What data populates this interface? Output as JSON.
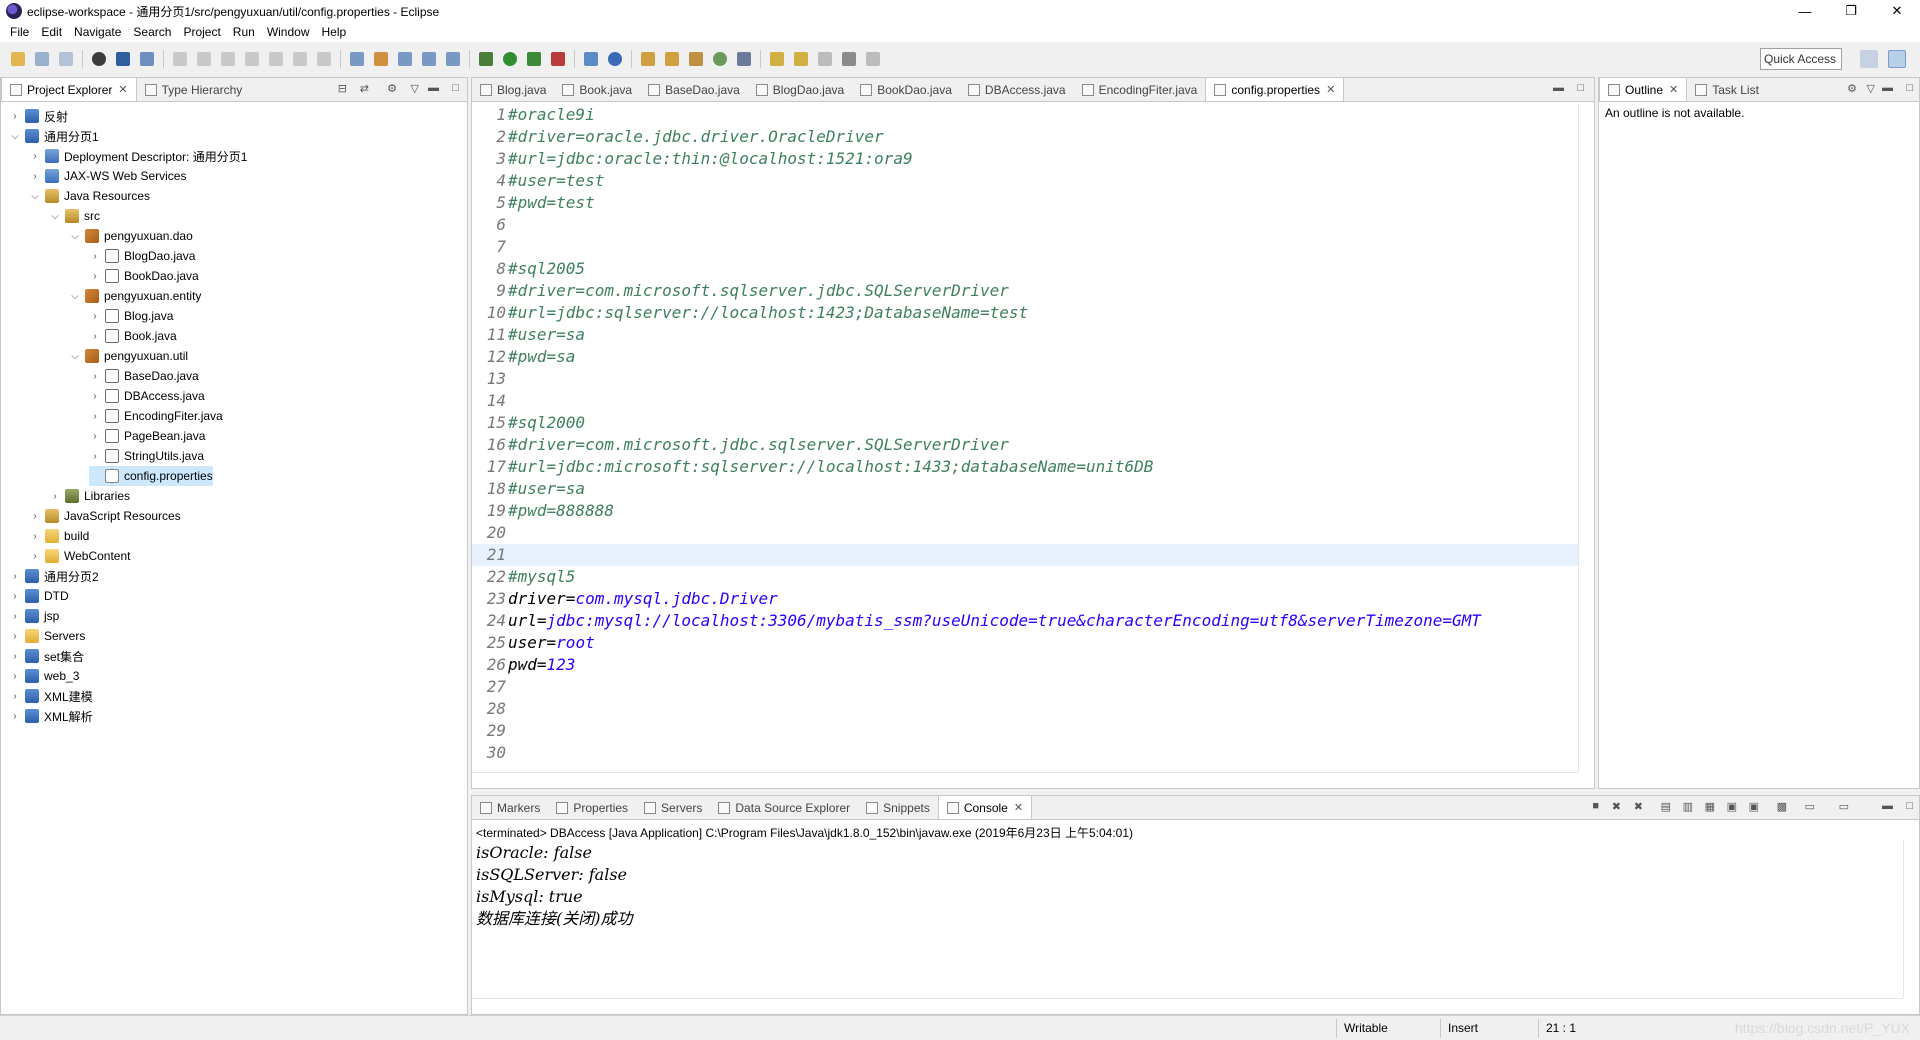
{
  "window": {
    "title": "eclipse-workspace - 通用分页1/src/pengyuxuan/util/config.properties - Eclipse",
    "minimize": "—",
    "maximize": "❐",
    "close": "✕"
  },
  "menu": [
    "File",
    "Edit",
    "Navigate",
    "Search",
    "Project",
    "Run",
    "Window",
    "Help"
  ],
  "toolbar": {
    "quick_access": "Quick Access"
  },
  "explorer": {
    "tabs": [
      {
        "label": "Project Explorer",
        "close": "✕"
      },
      {
        "label": "Type Hierarchy"
      }
    ],
    "tree": [
      {
        "label": "反射",
        "depth": 0,
        "expanded": false,
        "icon": "project-icon"
      },
      {
        "label": "通用分页1",
        "depth": 0,
        "expanded": true,
        "icon": "project-icon"
      },
      {
        "label": "Deployment Descriptor: 通用分页1",
        "depth": 1,
        "expanded": false,
        "icon": "descriptor-icon"
      },
      {
        "label": "JAX-WS Web Services",
        "depth": 1,
        "expanded": false,
        "icon": "webservice-icon"
      },
      {
        "label": "Java Resources",
        "depth": 1,
        "expanded": true,
        "icon": "java-resources-icon"
      },
      {
        "label": "src",
        "depth": 2,
        "expanded": true,
        "icon": "source-folder-icon"
      },
      {
        "label": "pengyuxuan.dao",
        "depth": 3,
        "expanded": true,
        "icon": "package-icon"
      },
      {
        "label": "BlogDao.java",
        "depth": 4,
        "expanded": false,
        "icon": "java-file-icon"
      },
      {
        "label": "BookDao.java",
        "depth": 4,
        "expanded": false,
        "icon": "java-file-icon"
      },
      {
        "label": "pengyuxuan.entity",
        "depth": 3,
        "expanded": true,
        "icon": "package-icon"
      },
      {
        "label": "Blog.java",
        "depth": 4,
        "expanded": false,
        "icon": "java-file-icon"
      },
      {
        "label": "Book.java",
        "depth": 4,
        "expanded": false,
        "icon": "java-file-icon"
      },
      {
        "label": "pengyuxuan.util",
        "depth": 3,
        "expanded": true,
        "icon": "package-icon"
      },
      {
        "label": "BaseDao.java",
        "depth": 4,
        "expanded": false,
        "icon": "java-file-icon"
      },
      {
        "label": "DBAccess.java",
        "depth": 4,
        "expanded": false,
        "icon": "java-file-icon"
      },
      {
        "label": "EncodingFiter.java",
        "depth": 4,
        "expanded": false,
        "icon": "java-file-icon"
      },
      {
        "label": "PageBean.java",
        "depth": 4,
        "expanded": false,
        "icon": "java-file-icon"
      },
      {
        "label": "StringUtils.java",
        "depth": 4,
        "expanded": false,
        "icon": "java-file-icon"
      },
      {
        "label": "config.properties",
        "depth": 4,
        "leaf": true,
        "selected": true,
        "icon": "properties-file-icon"
      },
      {
        "label": "Libraries",
        "depth": 2,
        "expanded": false,
        "icon": "library-icon"
      },
      {
        "label": "JavaScript Resources",
        "depth": 1,
        "expanded": false,
        "icon": "js-resources-icon"
      },
      {
        "label": "build",
        "depth": 1,
        "expanded": false,
        "icon": "folder-icon"
      },
      {
        "label": "WebContent",
        "depth": 1,
        "expanded": false,
        "icon": "folder-icon"
      },
      {
        "label": "通用分页2",
        "depth": 0,
        "expanded": false,
        "icon": "project-icon"
      },
      {
        "label": "DTD",
        "depth": 0,
        "expanded": false,
        "icon": "project-icon"
      },
      {
        "label": "jsp",
        "depth": 0,
        "expanded": false,
        "icon": "project-icon"
      },
      {
        "label": "Servers",
        "depth": 0,
        "expanded": false,
        "icon": "folder-icon"
      },
      {
        "label": "set集合",
        "depth": 0,
        "expanded": false,
        "icon": "project-icon"
      },
      {
        "label": "web_3",
        "depth": 0,
        "expanded": false,
        "icon": "project-icon"
      },
      {
        "label": "XML建模",
        "depth": 0,
        "expanded": false,
        "icon": "project-icon"
      },
      {
        "label": "XML解析",
        "depth": 0,
        "expanded": false,
        "icon": "project-icon"
      }
    ]
  },
  "editor": {
    "tabs": [
      {
        "label": "Blog.java"
      },
      {
        "label": "Book.java"
      },
      {
        "label": "BaseDao.java"
      },
      {
        "label": "BlogDao.java"
      },
      {
        "label": "BookDao.java"
      },
      {
        "label": "DBAccess.java"
      },
      {
        "label": "EncodingFiter.java"
      },
      {
        "label": "config.properties",
        "active": true,
        "close": "✕"
      }
    ],
    "current_line": 21,
    "lines": [
      {
        "n": "1",
        "type": "comment",
        "text": "#oracle9i"
      },
      {
        "n": "2",
        "type": "comment",
        "text": "#driver=oracle.jdbc.driver.OracleDriver"
      },
      {
        "n": "3",
        "type": "comment",
        "text": "#url=jdbc:oracle:thin:@localhost:1521:ora9"
      },
      {
        "n": "4",
        "type": "comment",
        "text": "#user=test"
      },
      {
        "n": "5",
        "type": "comment",
        "text": "#pwd=test"
      },
      {
        "n": "6",
        "type": "blank",
        "text": ""
      },
      {
        "n": "7",
        "type": "blank",
        "text": ""
      },
      {
        "n": "8",
        "type": "comment",
        "text": "#sql2005"
      },
      {
        "n": "9",
        "type": "comment",
        "text": "#driver=com.microsoft.sqlserver.jdbc.SQLServerDriver"
      },
      {
        "n": "10",
        "type": "comment",
        "text": "#url=jdbc:sqlserver://localhost:1423;DatabaseName=test"
      },
      {
        "n": "11",
        "type": "comment",
        "text": "#user=sa"
      },
      {
        "n": "12",
        "type": "comment",
        "text": "#pwd=sa"
      },
      {
        "n": "13",
        "type": "blank",
        "text": ""
      },
      {
        "n": "14",
        "type": "blank",
        "text": ""
      },
      {
        "n": "15",
        "type": "comment",
        "text": "#sql2000"
      },
      {
        "n": "16",
        "type": "comment",
        "text": "#driver=com.microsoft.jdbc.sqlserver.SQLServerDriver"
      },
      {
        "n": "17",
        "type": "comment",
        "text": "#url=jdbc:microsoft:sqlserver://localhost:1433;databaseName=unit6DB"
      },
      {
        "n": "18",
        "type": "comment",
        "text": "#user=sa"
      },
      {
        "n": "19",
        "type": "comment",
        "text": "#pwd=888888"
      },
      {
        "n": "20",
        "type": "blank",
        "text": ""
      },
      {
        "n": "21",
        "type": "blank",
        "text": ""
      },
      {
        "n": "22",
        "type": "comment",
        "text": "#mysql5"
      },
      {
        "n": "23",
        "type": "prop",
        "key": "driver=",
        "value": "com.mysql.jdbc.Driver"
      },
      {
        "n": "24",
        "type": "prop",
        "key": "url=",
        "value": "jdbc:mysql://localhost:3306/mybatis_ssm?useUnicode=true&characterEncoding=utf8&serverTimezone=GMT"
      },
      {
        "n": "25",
        "type": "prop",
        "key": "user=",
        "value": "root"
      },
      {
        "n": "26",
        "type": "prop",
        "key": "pwd=",
        "value": "123"
      },
      {
        "n": "27",
        "type": "blank",
        "text": ""
      },
      {
        "n": "28",
        "type": "blank",
        "text": ""
      },
      {
        "n": "29",
        "type": "blank",
        "text": ""
      },
      {
        "n": "30",
        "type": "blank",
        "text": ""
      }
    ]
  },
  "outline": {
    "tabs": [
      {
        "label": "Outline",
        "close": "✕"
      },
      {
        "label": "Task List"
      }
    ],
    "message": "An outline is not available."
  },
  "console_panel": {
    "tabs": [
      {
        "label": "Markers"
      },
      {
        "label": "Properties"
      },
      {
        "label": "Servers"
      },
      {
        "label": "Data Source Explorer"
      },
      {
        "label": "Snippets"
      },
      {
        "label": "Console",
        "active": true,
        "close": "✕"
      }
    ],
    "terminated": "<terminated> DBAccess [Java Application] C:\\Program Files\\Java\\jdk1.8.0_152\\bin\\javaw.exe (2019年6月23日 上午5:04:01)",
    "output": [
      "isOracle: false",
      "isSQLServer: false",
      "isMysql: true",
      "数据库连接(关闭)成功"
    ]
  },
  "status": {
    "writable": "Writable",
    "insert": "Insert",
    "position": "21 : 1",
    "watermark": "https://blog.csdn.net/P_YUX"
  },
  "colors": {
    "comment": "#3f7f5f",
    "value": "#2a00ff",
    "selection": "#cce8ff",
    "current_line": "#e8f2fe"
  }
}
